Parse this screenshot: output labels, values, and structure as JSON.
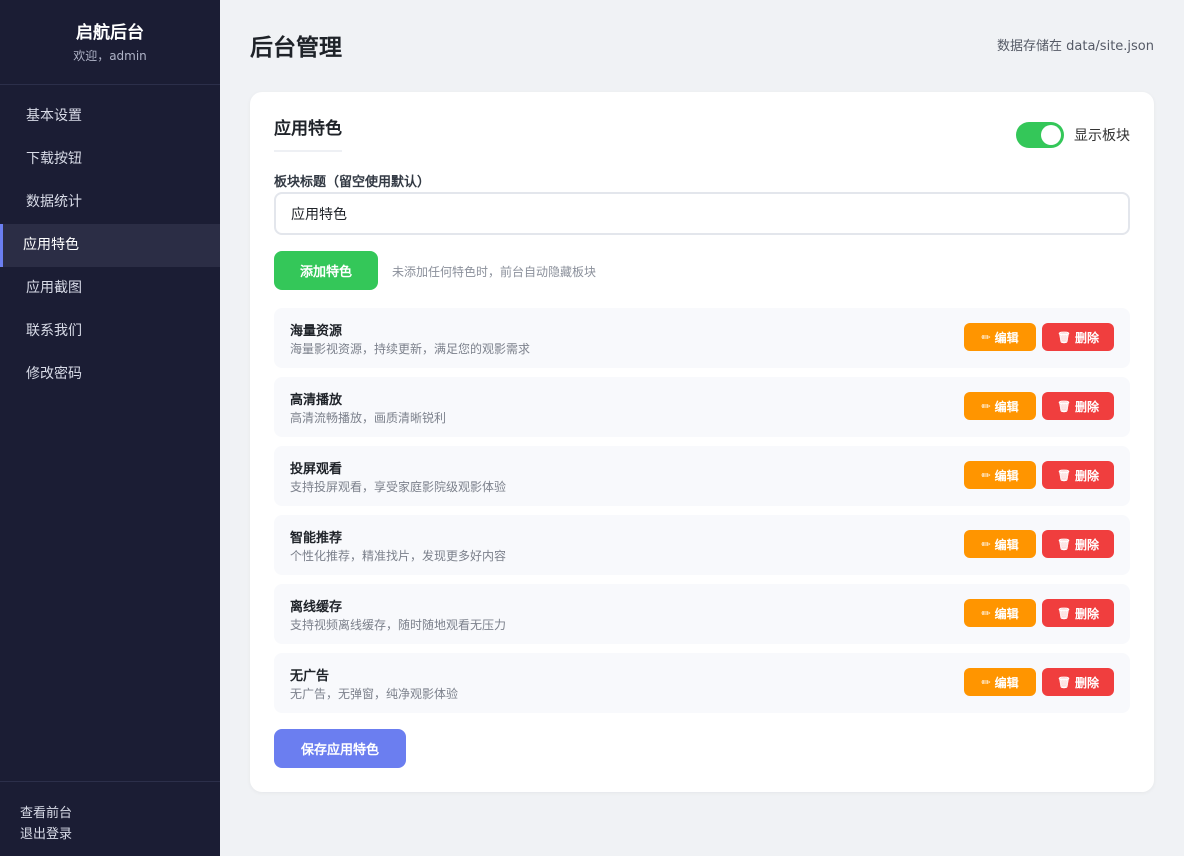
{
  "sidebar": {
    "brand_title": "启航后台",
    "welcome": "欢迎，admin",
    "items": [
      {
        "label": "基本设置"
      },
      {
        "label": "下载按钮"
      },
      {
        "label": "数据统计"
      },
      {
        "label": "应用特色",
        "active": true
      },
      {
        "label": "应用截图"
      },
      {
        "label": "联系我们"
      },
      {
        "label": "修改密码"
      }
    ],
    "footer": {
      "view_site": "查看前台",
      "logout": "退出登录"
    }
  },
  "header": {
    "title": "后台管理",
    "storage_note": "数据存储在 data/site.json"
  },
  "card": {
    "title": "应用特色",
    "toggle": {
      "label": "显示板块",
      "on": true
    },
    "field_label": "板块标题（留空使用默认）",
    "title_value": "应用特色",
    "add_button": "添加特色",
    "add_hint": "未添加任何特色时，前台自动隐藏板块",
    "edit_label": "编辑",
    "delete_label": "删除",
    "features": [
      {
        "title": "海量资源",
        "desc": "海量影视资源，持续更新，满足您的观影需求"
      },
      {
        "title": "高清播放",
        "desc": "高清流畅播放，画质清晰锐利"
      },
      {
        "title": "投屏观看",
        "desc": "支持投屏观看，享受家庭影院级观影体验"
      },
      {
        "title": "智能推荐",
        "desc": "个性化推荐，精准找片，发现更多好内容"
      },
      {
        "title": "离线缓存",
        "desc": "支持视频离线缓存，随时随地观看无压力"
      },
      {
        "title": "无广告",
        "desc": "无广告，无弹窗，纯净观影体验"
      }
    ],
    "save_button": "保存应用特色"
  },
  "colors": {
    "sidebar_bg": "#1b1d34",
    "accent": "#6b7ef0",
    "success": "#34c759",
    "warning": "#ff9500",
    "danger": "#f03e3e"
  },
  "icons": {
    "edit": "pencil-icon",
    "delete": "trash-icon"
  }
}
